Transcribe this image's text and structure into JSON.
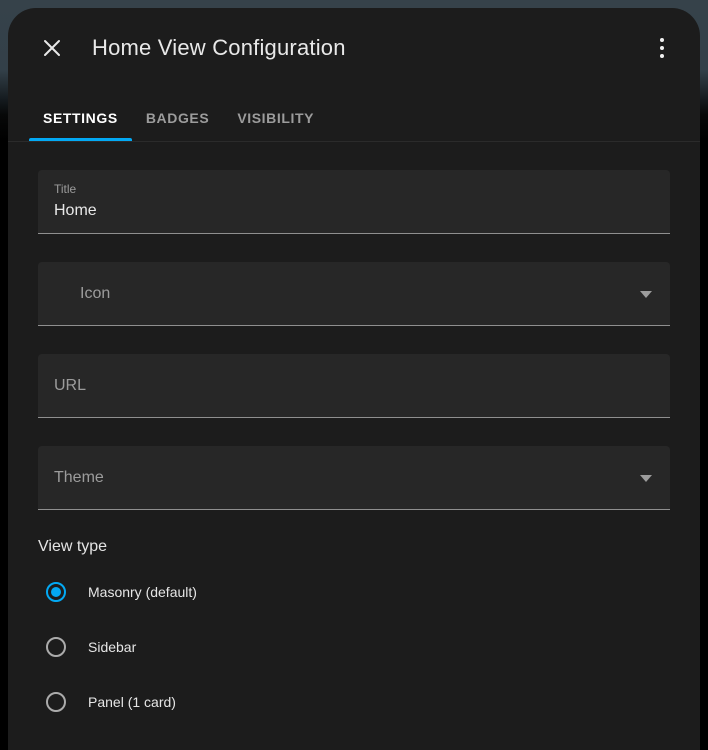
{
  "dialog": {
    "title": "Home View Configuration"
  },
  "tabs": [
    {
      "label": "SETTINGS",
      "active": true
    },
    {
      "label": "BADGES",
      "active": false
    },
    {
      "label": "VISIBILITY",
      "active": false
    }
  ],
  "form": {
    "title_field": {
      "label": "Title",
      "value": "Home"
    },
    "icon_field": {
      "label": "Icon"
    },
    "url_field": {
      "placeholder": "URL"
    },
    "theme_field": {
      "label": "Theme"
    },
    "view_type": {
      "label": "View type",
      "options": [
        {
          "label": "Masonry (default)",
          "selected": true
        },
        {
          "label": "Sidebar",
          "selected": false
        },
        {
          "label": "Panel (1 card)",
          "selected": false
        }
      ]
    }
  },
  "colors": {
    "accent": "#03a9f4",
    "dialog_background": "#1c1c1c",
    "field_background": "#272727",
    "backdrop_top": "#36424a"
  }
}
